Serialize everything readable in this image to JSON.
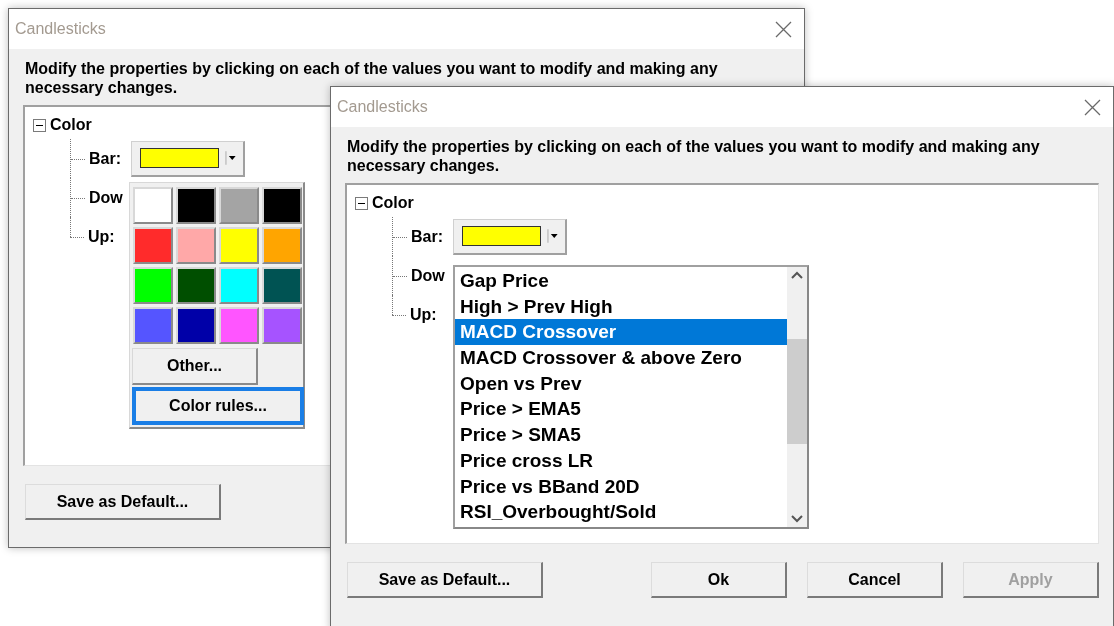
{
  "windows": [
    {
      "title": "Candlesticks",
      "instructions": "Modify the properties by clicking on each of the values you want to modify and making any necessary changes.",
      "tree": {
        "label": "Color",
        "expanded": true,
        "children": [
          {
            "label": "Bar:",
            "color": "#ffff00"
          },
          {
            "label": "Dow"
          },
          {
            "label": "Up:"
          }
        ]
      },
      "popup": {
        "kind": "palette",
        "swatches": [
          {
            "color": "#ffffff"
          },
          {
            "color": "#000000"
          },
          {
            "color": "#a4a4a4"
          },
          {
            "color": "#000000"
          },
          {
            "color": "#ff2b2b"
          },
          {
            "color": "#ffa8a8"
          },
          {
            "color": "#ffff00"
          },
          {
            "color": "#ffa500"
          },
          {
            "color": "#00ff00"
          },
          {
            "color": "#004f00"
          },
          {
            "color": "#00ffff"
          },
          {
            "color": "#005353"
          },
          {
            "color": "#5555ff"
          },
          {
            "color": "#0000a8"
          },
          {
            "color": "#ff55ff"
          },
          {
            "color": "#a653ff"
          }
        ],
        "buttons": [
          {
            "label": "Other...",
            "focused": false
          },
          {
            "label": "Color rules...",
            "focused": true
          }
        ]
      },
      "buttons": [
        {
          "label": "Save as Default...",
          "disabled": false
        }
      ]
    },
    {
      "title": "Candlesticks",
      "instructions": "Modify the properties by clicking on each of the values you want to modify and making any necessary changes.",
      "tree": {
        "label": "Color",
        "expanded": true,
        "children": [
          {
            "label": "Bar:",
            "color": "#ffff00"
          },
          {
            "label": "Dow"
          },
          {
            "label": "Up:"
          }
        ]
      },
      "popup": {
        "kind": "list",
        "items": [
          {
            "label": "Gap Price",
            "selected": false
          },
          {
            "label": "High > Prev High",
            "selected": false
          },
          {
            "label": "MACD Crossover",
            "selected": true
          },
          {
            "label": "MACD Crossover & above Zero",
            "selected": false
          },
          {
            "label": "Open vs Prev",
            "selected": false
          },
          {
            "label": "Price > EMA5",
            "selected": false
          },
          {
            "label": "Price > SMA5",
            "selected": false
          },
          {
            "label": "Price cross LR",
            "selected": false
          },
          {
            "label": "Price vs BBand 20D",
            "selected": false
          },
          {
            "label": "RSI_Overbought/Sold",
            "selected": false
          }
        ]
      },
      "buttons": [
        {
          "label": "Save as Default...",
          "disabled": false
        },
        {
          "label": "Ok",
          "disabled": false
        },
        {
          "label": "Cancel",
          "disabled": false
        },
        {
          "label": "Apply",
          "disabled": true
        }
      ]
    }
  ]
}
